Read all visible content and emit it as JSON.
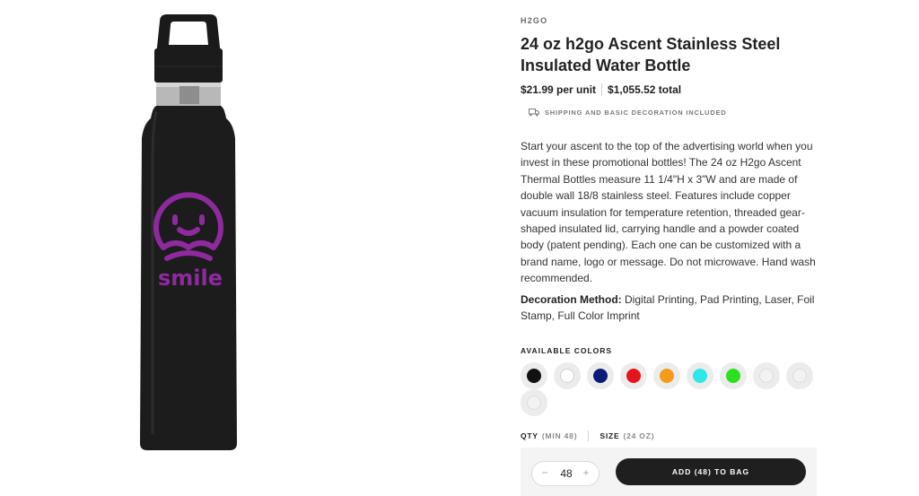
{
  "product": {
    "brand": "H2GO",
    "title": "24 oz h2go Ascent Stainless Steel Insulated Water Bottle",
    "price_unit": "$21.99 per unit",
    "price_total": "$1,055.52 total",
    "shipping_note": "SHIPPING AND BASIC DECORATION INCLUDED",
    "description": "Start your ascent to the top of the advertising world when you invest in these promotional bottles! The 24 oz H2go Ascent Thermal Bottles measure 11 1/4\"H x 3\"W and are made of double wall 18/8 stainless steel. Features include copper vacuum insulation for temperature retention, threaded gear-shaped insulated lid, carrying handle and a powder coated body (patent pending). Each one can be customized with a brand name, logo or message. Do not microwave. Hand wash recommended.",
    "decoration_label": "Decoration Method:",
    "decoration_value": "Digital Printing, Pad Printing, Laser, Foil Stamp, Full Color Imprint",
    "image": {
      "logo_text": "smile",
      "bottle_color": "#1c1c1c",
      "logo_color": "#8e2a9e",
      "icon": "water-bottle-image"
    }
  },
  "colors": {
    "label": "AVAILABLE COLORS",
    "swatches": [
      "#111111",
      "#ffffff",
      "#0a1a7a",
      "#e8141c",
      "#f49b1c",
      "#2fe6ea",
      "#2ddf21",
      "#f2f2f2",
      "#f2f2f2",
      "#f2f2f2"
    ]
  },
  "order": {
    "qty_label": "QTY",
    "qty_min": "(MIN 48)",
    "size_label": "SIZE",
    "size_value": "(24 OZ)",
    "qty_value": "48",
    "minus": "−",
    "plus": "+",
    "add_button": "ADD (48) TO BAG"
  },
  "icons": {
    "shipping": "truck-icon"
  }
}
